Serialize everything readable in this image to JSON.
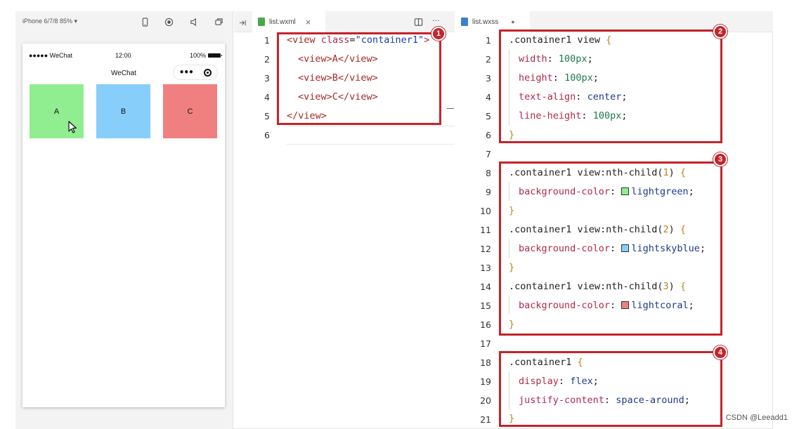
{
  "simulator": {
    "device_label": "iPhone 6/7/8 85% ▾",
    "toolbar_icons": [
      "phone-icon",
      "record-icon",
      "speaker-icon",
      "window-icon",
      "step-into-icon"
    ],
    "status": {
      "signal": "●●●●● WeChat",
      "time": "12:00",
      "battery": "100%"
    },
    "nav_title": "WeChat",
    "capsule_dots": "•••",
    "boxes": [
      {
        "label": "A",
        "color": "lightgreen",
        "hex": "#90ee90"
      },
      {
        "label": "B",
        "color": "lightskyblue",
        "hex": "#87cefa"
      },
      {
        "label": "C",
        "color": "lightcoral",
        "hex": "#f08080"
      }
    ]
  },
  "wxml_editor": {
    "tab_label": "list.wxml",
    "tab_close": "×",
    "split_icon": "split-editor-icon",
    "more": "···",
    "line_numbers": [
      "1",
      "2",
      "3",
      "4",
      "5",
      "6"
    ],
    "code": {
      "l1_open": "<view ",
      "l1_attr": "class",
      "l1_eq": "=",
      "l1_str": "\"container1\"",
      "l1_close": ">",
      "l2": "<view>A</view>",
      "l3": "<view>B</view>",
      "l4": "<view>C</view>",
      "l5": "</view>"
    },
    "badge": "1"
  },
  "wxss_editor": {
    "tab_label": "list.wxss",
    "tab_dot": "●",
    "line_numbers": [
      "1",
      "2",
      "3",
      "4",
      "5",
      "6",
      "7",
      "8",
      "9",
      "10",
      "11",
      "12",
      "13",
      "14",
      "15",
      "16",
      "17",
      "18",
      "19",
      "20",
      "21"
    ],
    "rules": {
      "r1_selector": ".container1 view ",
      "r1_width_prop": "width",
      "r1_width_val": "100px",
      "r1_height_prop": "height",
      "r1_height_val": "100px",
      "r1_align_prop": "text-align",
      "r1_align_val": "center",
      "r1_lh_prop": "line-height",
      "r1_lh_val": "100px",
      "r2_selector": ".container1 view:nth-child(",
      "r2_arg": "1",
      "r3_arg": "2",
      "r4_arg": "3",
      "bg_prop": "background-color",
      "c1": "lightgreen",
      "c2": "lightskyblue",
      "c3": "lightcoral",
      "r5_selector": ".container1 ",
      "display_prop": "display",
      "display_val": "flex",
      "justify_prop": "justify-content",
      "justify_val": "space-around",
      "open_brace": "{",
      "close_brace": "}",
      "colon": ":",
      "semicolon": ";",
      "close_paren": ") "
    },
    "badges": [
      "2",
      "3",
      "4"
    ]
  },
  "watermark": "CSDN @Leeadd1",
  "colors": {
    "accent_red": "#c4242a",
    "lightgreen": "#90ee90",
    "lightskyblue": "#87cefa",
    "lightcoral": "#f08080"
  }
}
